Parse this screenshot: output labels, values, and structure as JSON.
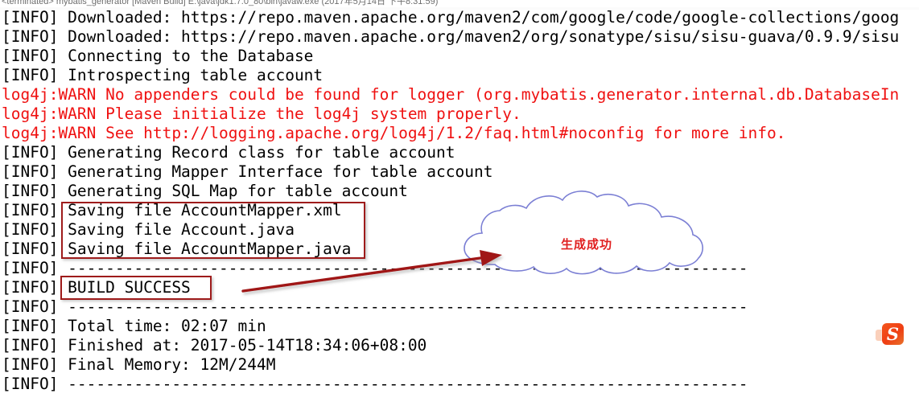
{
  "window": {
    "title": "<terminated> mybatis_generator [Maven Build] E:\\java\\jdk1.7.0_80\\bin\\javaw.exe (2017年5月14日 下午8:31:59)"
  },
  "console": {
    "lines": [
      {
        "text": "[INFO] Downloaded: https://repo.maven.apache.org/maven2/com/google/code/google-collections/goog",
        "kind": "info"
      },
      {
        "text": "[INFO] Downloaded: https://repo.maven.apache.org/maven2/org/sonatype/sisu/sisu-guava/0.9.9/sisu",
        "kind": "info"
      },
      {
        "text": "[INFO] Connecting to the Database",
        "kind": "info"
      },
      {
        "text": "[INFO] Introspecting table account",
        "kind": "info"
      },
      {
        "text": "log4j:WARN No appenders could be found for logger (org.mybatis.generator.internal.db.DatabaseIn",
        "kind": "warn"
      },
      {
        "text": "log4j:WARN Please initialize the log4j system properly.",
        "kind": "warn"
      },
      {
        "text": "log4j:WARN See http://logging.apache.org/log4j/1.2/faq.html#noconfig for more info.",
        "kind": "warn"
      },
      {
        "text": "[INFO] Generating Record class for table account",
        "kind": "info"
      },
      {
        "text": "[INFO] Generating Mapper Interface for table account",
        "kind": "info"
      },
      {
        "text": "[INFO] Generating SQL Map for table account",
        "kind": "info"
      },
      {
        "text": "[INFO] Saving file AccountMapper.xml",
        "kind": "info"
      },
      {
        "text": "[INFO] Saving file Account.java",
        "kind": "info"
      },
      {
        "text": "[INFO] Saving file AccountMapper.java",
        "kind": "info"
      },
      {
        "text": "[INFO] ------------------------------------------------------------------------",
        "kind": "sep"
      },
      {
        "text": "[INFO] BUILD SUCCESS",
        "kind": "info"
      },
      {
        "text": "[INFO] ------------------------------------------------------------------------",
        "kind": "sep"
      },
      {
        "text": "[INFO] Total time: 02:07 min",
        "kind": "info"
      },
      {
        "text": "[INFO] Finished at: 2017-05-14T18:34:06+08:00",
        "kind": "info"
      },
      {
        "text": "[INFO] Final Memory: 12M/244M",
        "kind": "info"
      },
      {
        "text": "[INFO] ------------------------------------------------------------------------",
        "kind": "sep"
      }
    ]
  },
  "annotations": {
    "highlight_box_saving_files_label": "Saving file AccountMapper.xml / Account.java / AccountMapper.java",
    "highlight_box_build_success_label": "BUILD SUCCESS",
    "cloud_text": "生成成功",
    "arrow_label": "arrow pointing to cloud callout"
  },
  "colors": {
    "info_text": "#000000",
    "warn_text": "#ef1111",
    "annotation_box": "#9e1b1b",
    "annotation_arrow": "#a01515",
    "cloud_outline": "#7b7fd4",
    "cloud_text": "#e02020",
    "watermark": "#ef3e13"
  },
  "watermark": {
    "letter": "S"
  }
}
